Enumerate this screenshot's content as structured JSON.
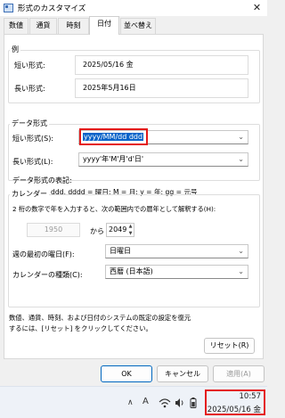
{
  "window": {
    "title": "形式のカスタマイズ",
    "close_glyph": "✕"
  },
  "tabs": [
    "数値",
    "通貨",
    "時刻",
    "日付",
    "並べ替え"
  ],
  "example": {
    "legend": "例",
    "short_label": "短い形式:",
    "short_value": "2025/05/16 金",
    "long_label": "長い形式:",
    "long_value": "2025年5月16日"
  },
  "date_formats": {
    "legend": "データ形式",
    "short_label": "短い形式(S):",
    "short_value": "yyyy/MM/dd ddd",
    "long_label": "長い形式(L):",
    "long_value": "yyyy'年'M'月'd'日'",
    "notation_title": "データ形式の表記:",
    "notation_text": "d, dd = 日;  ddd, dddd = 曜日; M = 月; y = 年; gg = 元号"
  },
  "calendar": {
    "legend": "カレンダー",
    "two_digit_desc": "2 桁の数字で年を入力すると、次の範囲内での暦年として解釈する(H):",
    "year_from": "1950",
    "year_from_label": "から",
    "year_to": "2049",
    "first_day_label": "週の最初の曜日(F):",
    "first_day_value": "日曜日",
    "calendar_type_label": "カレンダーの種類(C):",
    "calendar_type_value": "西暦 (日本語)"
  },
  "reset": {
    "desc_line1": "数値、通貨、時刻、および日付のシステムの既定の設定を復元",
    "desc_line2": "するには、[リセット] をクリックしてください。",
    "button": "リセット(R)"
  },
  "footer": {
    "ok": "OK",
    "cancel": "キャンセル",
    "apply": "適用(A)"
  },
  "taskbar": {
    "time": "10:57",
    "date": "2025/05/16 金",
    "chevron_glyph": "∧",
    "ime_glyph": "A"
  },
  "colors": {
    "accent": "#0067c0",
    "selection": "#0a63c9",
    "highlight_box": "#e41a1a"
  }
}
